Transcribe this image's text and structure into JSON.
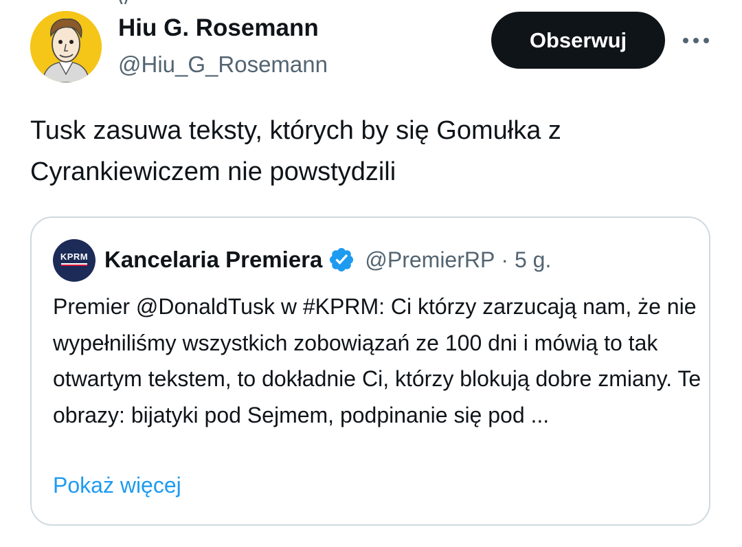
{
  "author": {
    "name": "Hiu G. Rosemann",
    "handle": "@Hiu_G_Rosemann",
    "follow_label": "Obserwuj",
    "avatar_bg": "#f5c518"
  },
  "more_icon": "more-horizontal-icon",
  "tweet": {
    "text": "Tusk zasuwa teksty, których by się Gomułka z Cyrankiewiczem nie powstydzili"
  },
  "quoted": {
    "avatar_text": "KPRM",
    "name": "Kancelaria Premiera",
    "verified_icon": "verified-badge-icon",
    "handle": "@PremierRP",
    "separator": "·",
    "time": "5 g.",
    "text": "Premier @DonaldTusk w #KPRM: Ci którzy zarzucają nam, że nie wypełniliśmy wszystkich zobowiązań ze 100 dni i mówią to tak otwartym tekstem, to dokładnie Ci, którzy blokują dobre zmiany. Te obrazy: bijatyki pod Sejmem, podpinanie się pod ...",
    "show_more": "Pokaż więcej"
  },
  "colors": {
    "text_primary": "#0f1419",
    "text_secondary": "#536471",
    "link": "#1d9bf0",
    "border": "#cfd9de",
    "verified": "#1d9bf0"
  }
}
